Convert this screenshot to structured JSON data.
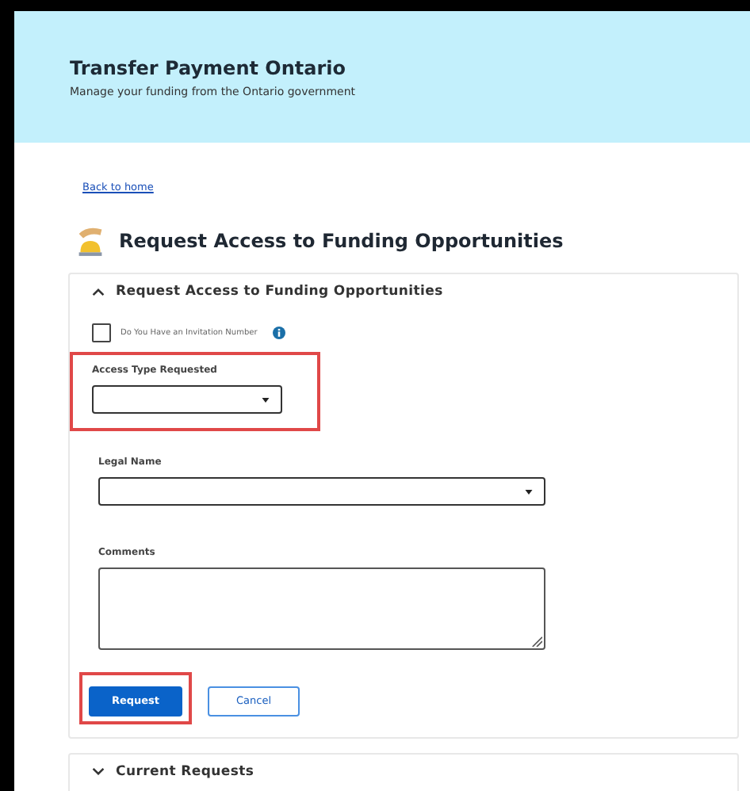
{
  "header": {
    "title": "Transfer Payment Ontario",
    "subtitle": "Manage your funding from the Ontario government"
  },
  "back_link": "Back to home",
  "page_title": "Request Access to Funding Opportunities",
  "sections": [
    {
      "title": "Request Access to Funding Opportunities",
      "expanded": true,
      "checkbox": {
        "label": "Do You Have an Invitation Number",
        "checked": false
      },
      "fields": [
        {
          "kind": "select",
          "label": "Access Type Requested",
          "wide": false,
          "highlighted": true
        },
        {
          "kind": "select",
          "label": "Legal Name",
          "wide": true,
          "highlighted": false
        },
        {
          "kind": "textarea",
          "label": "Comments",
          "wide": true,
          "highlighted": false
        }
      ],
      "buttons": [
        {
          "label": "Request",
          "kind": "primary",
          "highlighted": true
        },
        {
          "label": "Cancel",
          "kind": "secondary",
          "highlighted": false
        }
      ]
    },
    {
      "title": "Current Requests",
      "expanded": false
    }
  ]
}
